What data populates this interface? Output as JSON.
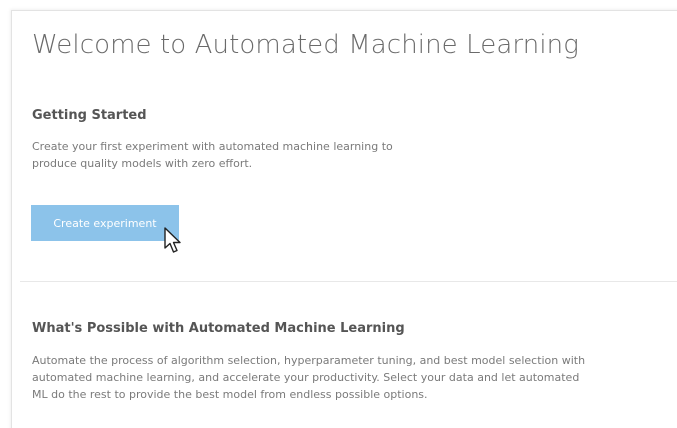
{
  "page": {
    "title": "Welcome to Automated Machine Learning"
  },
  "getting_started": {
    "heading": "Getting Started",
    "description": "Create your first experiment with automated machine learning to produce quality models with zero effort.",
    "button_label": "Create experiment"
  },
  "whats_possible": {
    "heading": "What's Possible with Automated Machine Learning",
    "description": "Automate the process of algorithm selection, hyperparameter tuning, and best model selection with automated machine learning, and accelerate your productivity. Select your data and let automated ML do the rest to provide the best model from endless possible options."
  },
  "icons": {
    "cursor": "mouse-pointer-icon"
  },
  "colors": {
    "button_bg": "#8cc3ea",
    "title_text": "#6a6a6a",
    "body_text": "#7a7a7a"
  }
}
